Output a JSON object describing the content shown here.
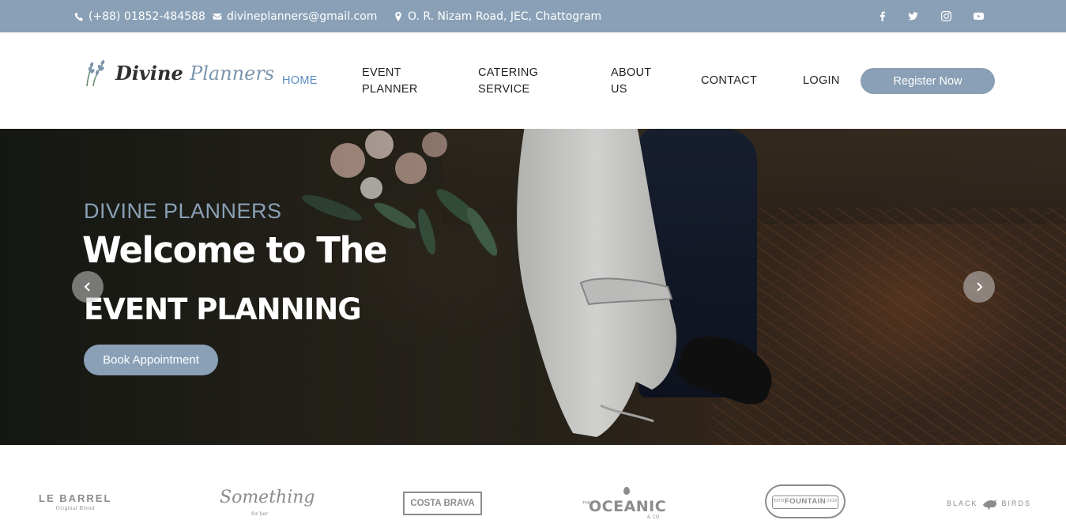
{
  "topbar": {
    "phone": "(+88) 01852-484588",
    "email": "divineplanners@gmail.com",
    "address": "O. R. Nizam Road, JEC, Chattogram",
    "social": [
      "facebook-icon",
      "twitter-icon",
      "instagram-icon",
      "youtube-icon"
    ],
    "bg_color": "#8aa0b6"
  },
  "header": {
    "logo": {
      "word1": "Divine",
      "word2": "Planners"
    },
    "nav": [
      {
        "label": "HOME",
        "active": true
      },
      {
        "label": "EVENT PLANNER",
        "active": false
      },
      {
        "label": "CATERING SERVICE",
        "active": false
      },
      {
        "label": "ABOUT US",
        "active": false
      },
      {
        "label": "CONTACT",
        "active": false
      },
      {
        "label": "LOGIN",
        "active": false
      }
    ],
    "register_label": "Register Now",
    "active_color": "#5b8cc4",
    "accent_color": "#8aa0b6"
  },
  "hero": {
    "subtitle": "DIVINE PLANNERS",
    "title_line1": "Welcome to The",
    "title_line2": "EVENT PLANNING",
    "cta_label": "Book Appointment",
    "prev_icon": "chevron-left-icon",
    "next_icon": "chevron-right-icon"
  },
  "brands": [
    {
      "name": "LE BARREL",
      "sub": "Original Blend"
    },
    {
      "name": "Something",
      "sub": "for her"
    },
    {
      "name": "COSTA BRAVA"
    },
    {
      "name": "OCEANIC",
      "prefix": "THE",
      "sub": "& CO"
    },
    {
      "name": "FOUNTAIN",
      "left": "ESTD",
      "right": "2019"
    },
    {
      "name_left": "BLACK",
      "name_right": "BIRDS"
    }
  ]
}
